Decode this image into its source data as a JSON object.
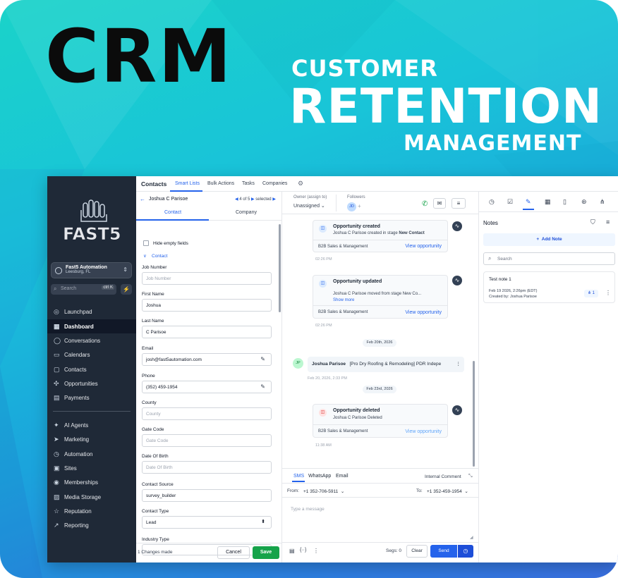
{
  "banner": {
    "big": "CRM",
    "line1": "CUSTOMER",
    "line2": "RETENTION",
    "line3": "MANAGEMENT"
  },
  "colors": {
    "accent": "#2563eb",
    "save": "#16a34a",
    "sidebar": "#1f2937"
  },
  "sidebar": {
    "logo_text": "FAST5",
    "account_name": "Fast5 Automation",
    "account_location": "Leesburg, FL",
    "search_placeholder": "Search",
    "search_shortcut": "ctrl K",
    "items": [
      {
        "label": "Launchpad",
        "icon": "launchpad-icon"
      },
      {
        "label": "Dashboard",
        "icon": "dashboard-icon"
      },
      {
        "label": "Conversations",
        "icon": "chat-icon"
      },
      {
        "label": "Calendars",
        "icon": "calendar-icon"
      },
      {
        "label": "Contacts",
        "icon": "contacts-icon"
      },
      {
        "label": "Opportunities",
        "icon": "opportunities-icon"
      },
      {
        "label": "Payments",
        "icon": "payments-icon"
      },
      {
        "label": "AI Agents",
        "icon": "ai-agents-icon"
      },
      {
        "label": "Marketing",
        "icon": "marketing-icon"
      },
      {
        "label": "Automation",
        "icon": "automation-icon"
      },
      {
        "label": "Sites",
        "icon": "sites-icon"
      },
      {
        "label": "Memberships",
        "icon": "memberships-icon"
      },
      {
        "label": "Media Storage",
        "icon": "media-icon"
      },
      {
        "label": "Reputation",
        "icon": "reputation-icon"
      },
      {
        "label": "Reporting",
        "icon": "reporting-icon"
      }
    ]
  },
  "topbar": {
    "title": "Contacts",
    "tabs": [
      "Smart Lists",
      "Bulk Actions",
      "Tasks",
      "Companies"
    ]
  },
  "contact": {
    "name": "Joshua C Parisoe",
    "count": "4 of 5",
    "selected": "selected",
    "tabs": [
      "Contact",
      "Company"
    ],
    "hide_empty": "Hide empty fields",
    "section": "Contact",
    "fields": [
      {
        "label": "Job Number",
        "value": "",
        "placeholder": "Job Number"
      },
      {
        "label": "First Name",
        "value": "Joshua",
        "placeholder": ""
      },
      {
        "label": "Last Name",
        "value": "C Parisoe",
        "placeholder": ""
      },
      {
        "label": "Email",
        "value": "josh@fast5automation.com",
        "placeholder": ""
      },
      {
        "label": "Phone",
        "value": "(352) 459-1954",
        "placeholder": ""
      },
      {
        "label": "County",
        "value": "",
        "placeholder": "County"
      },
      {
        "label": "Gate Code",
        "value": "",
        "placeholder": "Gate Code"
      },
      {
        "label": "Date Of Birth",
        "value": "",
        "placeholder": "Date Of Birth"
      },
      {
        "label": "Contact Source",
        "value": "survey_builder",
        "placeholder": ""
      },
      {
        "label": "Contact Type",
        "value": "Lead",
        "placeholder": ""
      },
      {
        "label": "Industry Type",
        "value": "",
        "placeholder": ""
      }
    ],
    "changes": "1 Changes made",
    "cancel": "Cancel",
    "save": "Save"
  },
  "conversation": {
    "owner_label": "Owner (assign to)",
    "owner_value": "Unassigned",
    "followers_label": "Followers",
    "follower_initials": "JD",
    "events": [
      {
        "title": "Opportunity created",
        "sub_pre": "Joshua C Parisoe created in stage ",
        "sub_bold": "New Contact",
        "pipeline": "B2B Sales & Management",
        "link": "View opportunity",
        "time": "02:26 PM"
      },
      {
        "title": "Opportunity updated",
        "sub_pre": "Joshua C Parisoe moved from stage New Co...",
        "sub_bold": "",
        "show_more": "Show more",
        "pipeline": "B2B Sales & Management",
        "link": "View opportunity",
        "time": "02:26 PM"
      },
      {
        "title": "Opportunity deleted",
        "sub_pre": "Joshua C Parisoe Deleted",
        "sub_bold": "",
        "pipeline": "B2B Sales & Management",
        "link": "View opportunity",
        "time": "11:38 AM"
      }
    ],
    "date1": "Feb 20th, 2026",
    "date2": "Feb 23rd, 2026",
    "msg_initials": "JP",
    "msg_name": "Joshua Parisoe",
    "msg_text": "[Pro Dry Roofing & Remodeling] PDR Indepe",
    "msg_time": "Feb 20, 2026, 2:33 PM",
    "channels": [
      "SMS",
      "WhatsApp",
      "Email"
    ],
    "internal": "Internal Comment",
    "from_label": "From:",
    "from_number": "+1 352-706-5911",
    "to_label": "To:",
    "to_number": "+1 352-459-1954",
    "placeholder": "Type a message",
    "segs": "Segs: 0",
    "clear": "Clear",
    "send": "Send"
  },
  "notes": {
    "title": "Notes",
    "add": "Add Note",
    "search_placeholder": "Search",
    "note_title": "Test note 1",
    "note_date": "Feb 19 2026, 2:26pm (EDT)",
    "note_author": "Created by: Joshua Parisoe",
    "note_count": "1"
  }
}
